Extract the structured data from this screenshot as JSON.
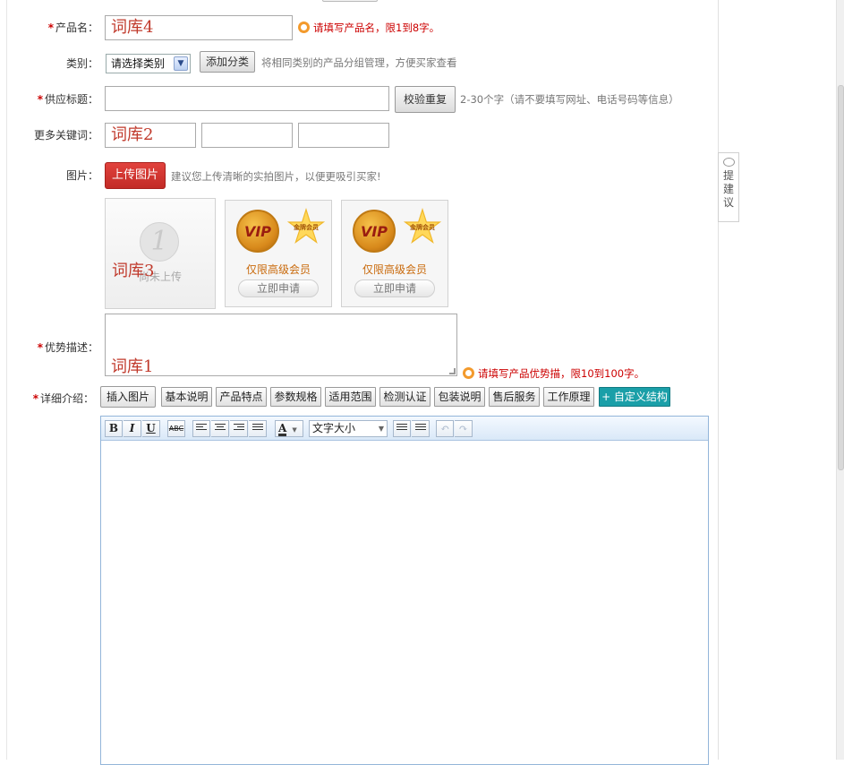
{
  "form": {
    "product_name": {
      "label": "产品名：",
      "value": "词库4",
      "hint": "请填写产品名，限1到8字。"
    },
    "category": {
      "label": "类别：",
      "select_value": "请选择类别",
      "add_button": "添加分类",
      "hint": "将相同类别的产品分组管理，方便买家查看"
    },
    "supply_title": {
      "label": "供应标题：",
      "value": "",
      "check_button": "校验重复",
      "hint": "2-30个字（请不要填写网址、电话号码等信息）"
    },
    "keywords": {
      "label": "更多关键词：",
      "values": [
        "词库2",
        "",
        ""
      ]
    },
    "image": {
      "label": "图片：",
      "upload_button": "上传图片",
      "hint": "建议您上传清晰的实拍图片，以便更吸引买家!",
      "slots": [
        {
          "number": "1",
          "status": "尚未上传",
          "overlay_text": "词库3"
        },
        {
          "vip_badge": "VIP",
          "medal_text": "金牌会员",
          "title": "仅限高级会员",
          "action": "立即申请"
        },
        {
          "vip_badge": "VIP",
          "medal_text": "金牌会员",
          "title": "仅限高级会员",
          "action": "立即申请"
        }
      ]
    },
    "advantage": {
      "label": "优势描述：",
      "value": "词库1",
      "hint": "请填写产品优势描，限10到100字。"
    },
    "details": {
      "label": "详细介绍：",
      "buttons": [
        "插入图片",
        "基本说明",
        "产品特点",
        "参数规格",
        "适用范围",
        "检测认证",
        "包装说明",
        "售后服务",
        "工作原理",
        "+ 自定义结构"
      ]
    }
  },
  "editor_toolbar": {
    "bold": "B",
    "italic": "I",
    "underline": "U",
    "strike": "ABC",
    "font_color": "A",
    "font_size": "文字大小",
    "undo": "↶",
    "redo": "↷"
  },
  "sidebar": {
    "suggest_chars": [
      "提",
      "建",
      "议"
    ]
  },
  "colors": {
    "required_star": "#cc0000",
    "upload_button": "#d0332e",
    "custom_structure": "#1a9fa8",
    "warn_text": "#cc0000"
  }
}
